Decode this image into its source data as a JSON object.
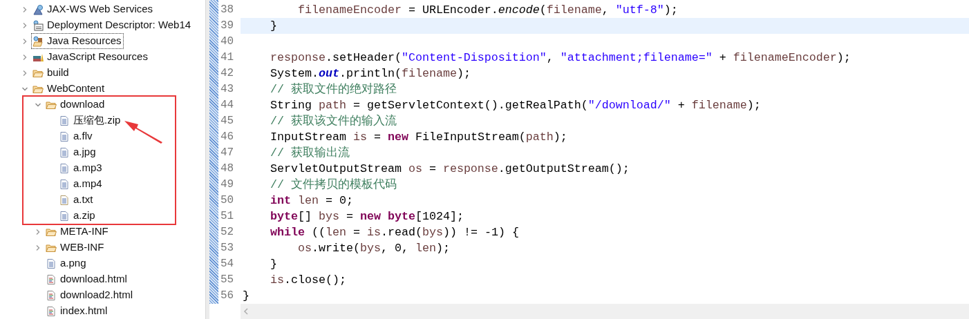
{
  "project_tree": [
    {
      "label": "JAX-WS Web Services",
      "kind": "webservices",
      "expanded": false,
      "focused": false
    },
    {
      "label": "Deployment Descriptor: Web14",
      "kind": "descriptor",
      "expanded": false,
      "focused": false
    },
    {
      "label": "Java Resources",
      "kind": "java-resources",
      "expanded": false,
      "focused": true
    },
    {
      "label": "JavaScript Resources",
      "kind": "js-resources",
      "expanded": false,
      "focused": false
    },
    {
      "label": "build",
      "kind": "folder",
      "expanded": false,
      "focused": false
    },
    {
      "label": "WebContent",
      "kind": "folder",
      "expanded": true,
      "focused": false,
      "children": [
        {
          "label": "download",
          "kind": "folder",
          "expanded": true,
          "focused": false,
          "highlighted": true,
          "children": [
            {
              "label": "压缩包.zip",
              "kind": "file",
              "focused": false,
              "pointed": true
            },
            {
              "label": "a.flv",
              "kind": "file",
              "focused": false
            },
            {
              "label": "a.jpg",
              "kind": "file",
              "focused": false
            },
            {
              "label": "a.mp3",
              "kind": "file",
              "focused": false
            },
            {
              "label": "a.mp4",
              "kind": "file",
              "focused": false
            },
            {
              "label": "a.txt",
              "kind": "text-file",
              "focused": false
            },
            {
              "label": "a.zip",
              "kind": "file",
              "focused": false
            }
          ]
        },
        {
          "label": "META-INF",
          "kind": "folder",
          "expanded": false,
          "focused": false
        },
        {
          "label": "WEB-INF",
          "kind": "folder",
          "expanded": false,
          "focused": false
        },
        {
          "label": "a.png",
          "kind": "file",
          "focused": false
        },
        {
          "label": "download.html",
          "kind": "html-file",
          "focused": false
        },
        {
          "label": "download2.html",
          "kind": "html-file",
          "focused": false
        },
        {
          "label": "index.html",
          "kind": "html-file",
          "focused": false
        }
      ]
    }
  ],
  "editor": {
    "lines": [
      {
        "number": "38",
        "current": false,
        "tokens": [
          {
            "kind": "field",
            "text": "        filenameEncoder"
          },
          {
            "kind": "plain",
            "text": " = URLEncoder."
          },
          {
            "kind": "static-method",
            "text": "encode"
          },
          {
            "kind": "plain",
            "text": "("
          },
          {
            "kind": "field",
            "text": "filename"
          },
          {
            "kind": "plain",
            "text": ", "
          },
          {
            "kind": "string",
            "text": "\"utf-8\""
          },
          {
            "kind": "plain",
            "text": ");"
          }
        ]
      },
      {
        "number": "39",
        "current": true,
        "tokens": [
          {
            "kind": "plain",
            "text": "    }"
          }
        ]
      },
      {
        "number": "40",
        "current": false
      },
      {
        "number": "41",
        "current": false,
        "tokens": [
          {
            "kind": "field",
            "text": "    response"
          },
          {
            "kind": "plain",
            "text": ".setHeader("
          },
          {
            "kind": "string",
            "text": "\"Content-Disposition\""
          },
          {
            "kind": "plain",
            "text": ", "
          },
          {
            "kind": "string",
            "text": "\"attachment;filename=\""
          },
          {
            "kind": "plain",
            "text": " + "
          },
          {
            "kind": "field",
            "text": "filenameEncoder"
          },
          {
            "kind": "plain",
            "text": ");"
          }
        ]
      },
      {
        "number": "42",
        "current": false,
        "tokens": [
          {
            "kind": "plain",
            "text": "    System."
          },
          {
            "kind": "static-field",
            "text": "out"
          },
          {
            "kind": "plain",
            "text": ".println("
          },
          {
            "kind": "field",
            "text": "filename"
          },
          {
            "kind": "plain",
            "text": ");"
          }
        ]
      },
      {
        "number": "43",
        "current": false,
        "tokens": [
          {
            "kind": "comment",
            "text": "    // 获取文件的绝对路径"
          }
        ]
      },
      {
        "number": "44",
        "current": false,
        "tokens": [
          {
            "kind": "plain",
            "text": "    String "
          },
          {
            "kind": "field",
            "text": "path"
          },
          {
            "kind": "plain",
            "text": " = getServletContext().getRealPath("
          },
          {
            "kind": "string",
            "text": "\"/download/\""
          },
          {
            "kind": "plain",
            "text": " + "
          },
          {
            "kind": "field",
            "text": "filename"
          },
          {
            "kind": "plain",
            "text": ");"
          }
        ]
      },
      {
        "number": "45",
        "current": false,
        "tokens": [
          {
            "kind": "comment",
            "text": "    // 获取该文件的输入流"
          }
        ]
      },
      {
        "number": "46",
        "current": false,
        "tokens": [
          {
            "kind": "plain",
            "text": "    InputStream "
          },
          {
            "kind": "field",
            "text": "is"
          },
          {
            "kind": "plain",
            "text": " = "
          },
          {
            "kind": "keyword",
            "text": "new"
          },
          {
            "kind": "plain",
            "text": " FileInputStream("
          },
          {
            "kind": "field",
            "text": "path"
          },
          {
            "kind": "plain",
            "text": ");"
          }
        ]
      },
      {
        "number": "47",
        "current": false,
        "tokens": [
          {
            "kind": "comment",
            "text": "    // 获取输出流"
          }
        ]
      },
      {
        "number": "48",
        "current": false,
        "tokens": [
          {
            "kind": "plain",
            "text": "    ServletOutputStream "
          },
          {
            "kind": "field",
            "text": "os"
          },
          {
            "kind": "plain",
            "text": " = "
          },
          {
            "kind": "field",
            "text": "response"
          },
          {
            "kind": "plain",
            "text": ".getOutputStream();"
          }
        ]
      },
      {
        "number": "49",
        "current": false,
        "tokens": [
          {
            "kind": "comment",
            "text": "    // 文件拷贝的模板代码"
          }
        ]
      },
      {
        "number": "50",
        "current": false,
        "tokens": [
          {
            "kind": "keyword",
            "text": "    int"
          },
          {
            "kind": "field",
            "text": " len"
          },
          {
            "kind": "plain",
            "text": " = 0;"
          }
        ]
      },
      {
        "number": "51",
        "current": false,
        "tokens": [
          {
            "kind": "keyword",
            "text": "    byte"
          },
          {
            "kind": "plain",
            "text": "[] "
          },
          {
            "kind": "field",
            "text": "bys"
          },
          {
            "kind": "plain",
            "text": " = "
          },
          {
            "kind": "keyword",
            "text": "new"
          },
          {
            "kind": "keyword",
            "text": " byte"
          },
          {
            "kind": "plain",
            "text": "[1024];"
          }
        ]
      },
      {
        "number": "52",
        "current": false,
        "tokens": [
          {
            "kind": "keyword",
            "text": "    while"
          },
          {
            "kind": "plain",
            "text": " (("
          },
          {
            "kind": "field",
            "text": "len"
          },
          {
            "kind": "plain",
            "text": " = "
          },
          {
            "kind": "field",
            "text": "is"
          },
          {
            "kind": "plain",
            "text": ".read("
          },
          {
            "kind": "field",
            "text": "bys"
          },
          {
            "kind": "plain",
            "text": ")) != -1) {"
          }
        ]
      },
      {
        "number": "53",
        "current": false,
        "tokens": [
          {
            "kind": "field",
            "text": "        os"
          },
          {
            "kind": "plain",
            "text": ".write("
          },
          {
            "kind": "field",
            "text": "bys"
          },
          {
            "kind": "plain",
            "text": ", 0, "
          },
          {
            "kind": "field",
            "text": "len"
          },
          {
            "kind": "plain",
            "text": ");"
          }
        ]
      },
      {
        "number": "54",
        "current": false,
        "tokens": [
          {
            "kind": "plain",
            "text": "    }"
          }
        ]
      },
      {
        "number": "55",
        "current": false,
        "tokens": [
          {
            "kind": "field",
            "text": "    is"
          },
          {
            "kind": "plain",
            "text": ".close();"
          }
        ]
      },
      {
        "number": "56",
        "current": false,
        "tokens": [
          {
            "kind": "plain",
            "text": "}"
          }
        ]
      }
    ]
  }
}
